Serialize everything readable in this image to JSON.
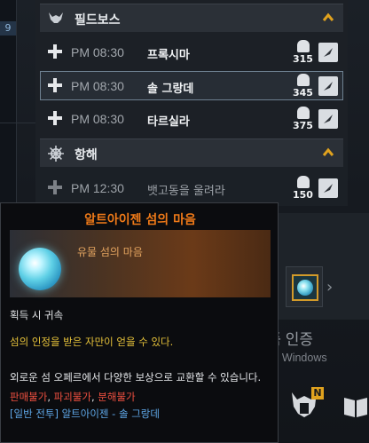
{
  "background": {
    "left_badge": "9"
  },
  "event_panel": {
    "sections": [
      {
        "title": "필드보스",
        "icon": "demon-head-icon",
        "rows": [
          {
            "time": "PM 08:30",
            "name": "프록시마",
            "level": "315",
            "selected": false
          },
          {
            "time": "PM 08:30",
            "name": "솔 그랑데",
            "level": "345",
            "selected": true
          },
          {
            "time": "PM 08:30",
            "name": "타르실라",
            "level": "375",
            "selected": false
          }
        ]
      },
      {
        "title": "항해",
        "icon": "ship-wheel-icon",
        "rows": [
          {
            "time": "PM 12:30",
            "name": "뱃고동을 울려라",
            "level": "150",
            "selected": false
          }
        ]
      }
    ]
  },
  "tooltip": {
    "title": "알트아이젠 섬의 마음",
    "subtitle": "유물 섬의 마음",
    "bind_info": "획득 시 귀속",
    "description": "섬의 인정을 받은 자만이 얻을 수 있다.",
    "usage": "외로운 섬 오페르에서 다양한 보상으로 교환할 수 있습니다.",
    "restrictions": [
      "판매불가",
      "파괴불가",
      "분해불가"
    ],
    "source": "[일반 전투] 알트아이젠 - 솔 그랑데"
  },
  "watermark": {
    "title": "Windows 정품 인증",
    "subtitle": "[설정]으로 이동하여 Windows"
  },
  "hud": {
    "badge": "N"
  },
  "colors": {
    "title_orange": "#f07a18",
    "description_yellow": "#e6c23a",
    "restriction_red": "#f05040",
    "source_blue": "#5fa8e8",
    "header_chevron": "#e0a21e"
  }
}
